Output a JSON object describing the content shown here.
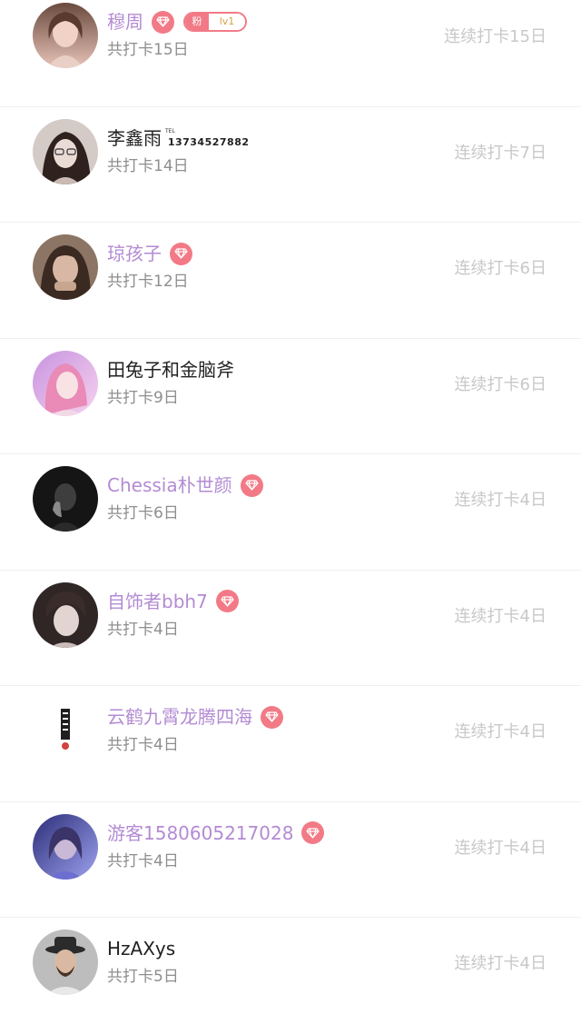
{
  "users": [
    {
      "name": "穆周",
      "vip": true,
      "gem": true,
      "fan_badge": {
        "left": "粉",
        "right": "lv1"
      },
      "total": "共打卡15日",
      "streak": "连续打卡15日",
      "avatar_colors": [
        "#e8c3b8",
        "#7a5a4e"
      ]
    },
    {
      "name": "李鑫雨",
      "vip": false,
      "gem": false,
      "tel": {
        "label": "TEL",
        "number": "13734527882"
      },
      "total": "共打卡14日",
      "streak": "连续打卡7日",
      "avatar_colors": [
        "#d9d2d0",
        "#3c2b28"
      ]
    },
    {
      "name": "琼孩子",
      "vip": true,
      "gem": true,
      "total": "共打卡12日",
      "streak": "连续打卡6日",
      "avatar_colors": [
        "#a9907e",
        "#3a2b22"
      ]
    },
    {
      "name": "田兔子和金脑斧",
      "vip": false,
      "gem": false,
      "total": "共打卡9日",
      "streak": "连续打卡6日",
      "avatar_colors": [
        "#f2c9e8",
        "#c68fd8"
      ]
    },
    {
      "name": "Chessia朴世颜",
      "vip": true,
      "gem": true,
      "total": "共打卡6日",
      "streak": "连续打卡4日",
      "avatar_colors": [
        "#3a3a3a",
        "#0f0f0f"
      ]
    },
    {
      "name": "自饰者bbh7",
      "vip": true,
      "gem": true,
      "total": "共打卡4日",
      "streak": "连续打卡4日",
      "avatar_colors": [
        "#cfc4c2",
        "#3b302f"
      ]
    },
    {
      "name": "云鹤九霄龙腾四海",
      "vip": true,
      "gem": true,
      "total": "共打卡4日",
      "streak": "连续打卡4日",
      "avatar_colors": [
        "#ffffff",
        "#222222"
      ]
    },
    {
      "name": "游客1580605217028",
      "vip": true,
      "gem": true,
      "total": "共打卡4日",
      "streak": "连续打卡4日",
      "avatar_colors": [
        "#7c7fd8",
        "#2a2b6e"
      ]
    },
    {
      "name": "HzAXys",
      "vip": false,
      "gem": false,
      "total": "共打卡5日",
      "streak": "连续打卡4日",
      "avatar_colors": [
        "#b9b9b9",
        "#2f2f2f"
      ]
    }
  ]
}
